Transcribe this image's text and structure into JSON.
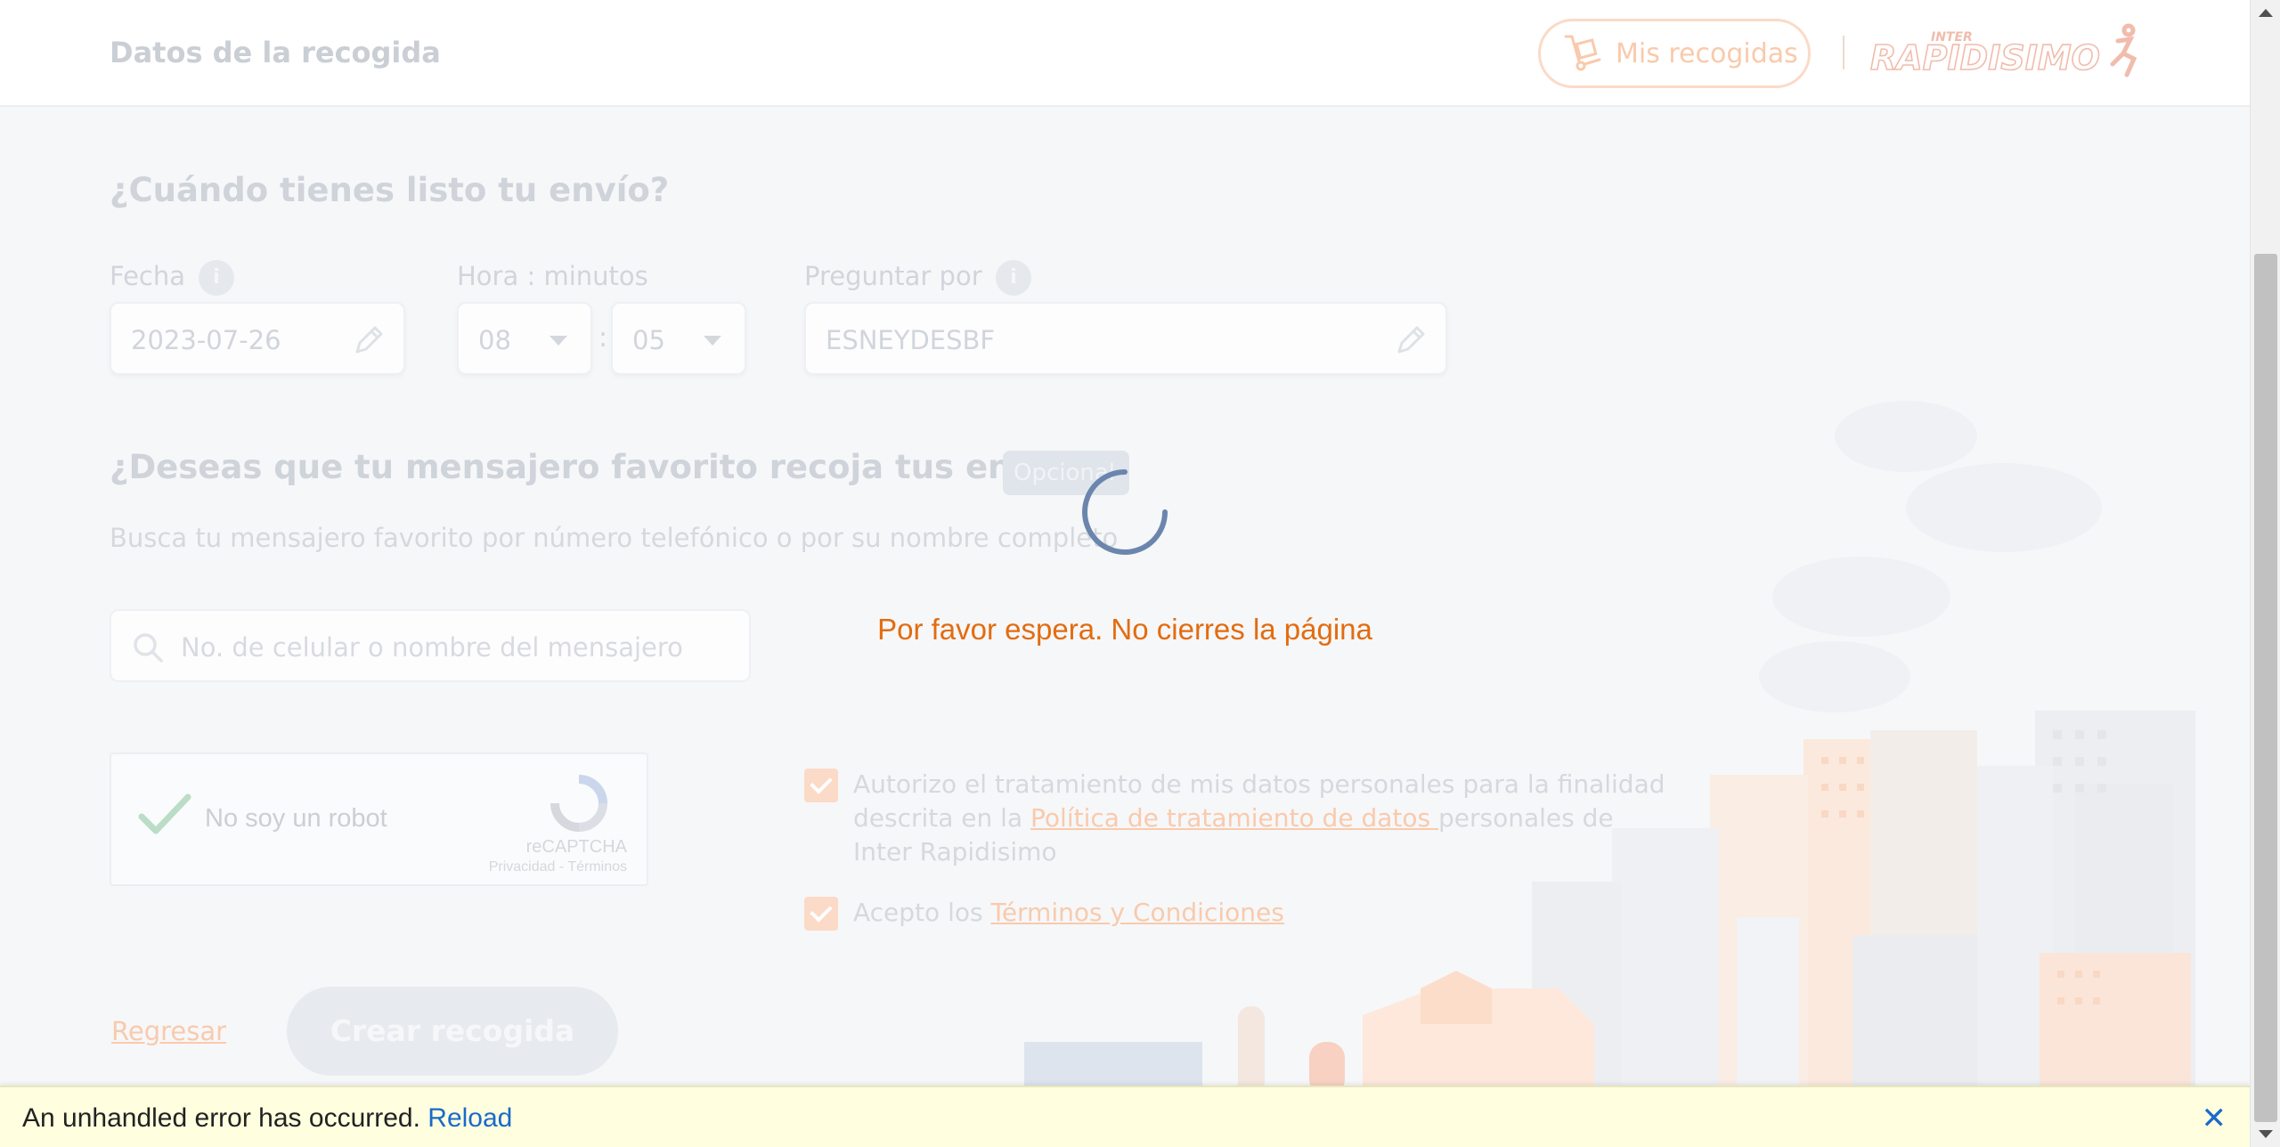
{
  "header": {
    "title": "Datos de la recogida",
    "my_pickups_label": "Mis recogidas",
    "logo_small": "INTER",
    "logo_main": "RAPIDISIMO",
    "icons": {
      "my_pickups": "hand-truck-icon",
      "logo": "runner-logo"
    }
  },
  "ready": {
    "title": "¿Cuándo tienes listo tu envío?",
    "date_label": "Fecha",
    "date_value": "2023-07-26",
    "time_label": "Hora : minutos",
    "hour_value": "08",
    "minute_value": "05",
    "time_separator": ":",
    "ask_for_label": "Preguntar por",
    "ask_for_value": "ESNEYDESBF",
    "info_glyph": "i"
  },
  "courier": {
    "title": "¿Deseas que tu mensajero favorito recoja tus envíos?",
    "optional_badge": "Opcional",
    "hint": "Busca tu mensajero favorito por número telefónico o por su nombre completo",
    "search_placeholder": "No. de celular o nombre del mensajero"
  },
  "recaptcha": {
    "label": "No soy un robot",
    "brand": "reCAPTCHA",
    "links": "Privacidad - Términos"
  },
  "consent": {
    "line1": "Autorizo el tratamiento de mis datos personales para la finalidad",
    "line2_pre": "descrita en la ",
    "policy_link": "Política de tratamiento de datos ",
    "line2_post": "personales de",
    "line3": "Inter Rapidisimo",
    "terms_pre": "Acepto los ",
    "terms_link": "Términos y Condiciones"
  },
  "actions": {
    "back_label": "Regresar",
    "create_label": "Crear recogida"
  },
  "loading": {
    "message": "Por favor espera. No cierres la página"
  },
  "error_bar": {
    "message": "An unhandled error has occurred.",
    "reload_label": "Reload",
    "close_glyph": "✕"
  },
  "colors": {
    "accent": "#e36c0f",
    "link": "#1b6ac9",
    "spinner": "#6b86ad",
    "error_bg": "#ffffe0"
  }
}
